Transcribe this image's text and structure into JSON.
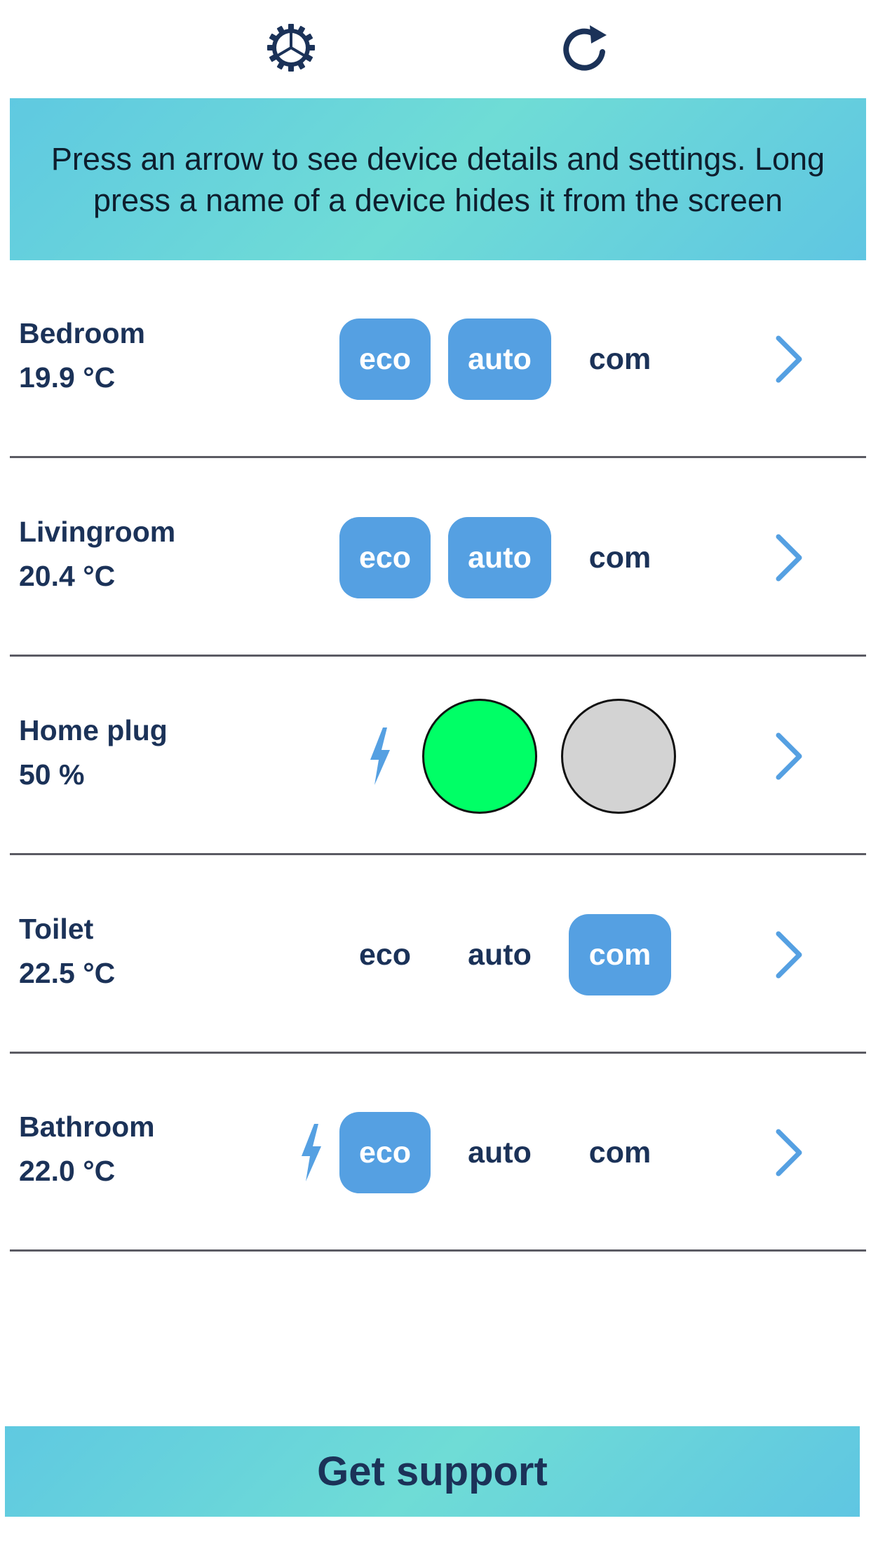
{
  "header": {
    "settings_icon": "gear-icon",
    "refresh_icon": "refresh-icon"
  },
  "info": {
    "text": "Press an arrow to see device details and settings. Long press a name of a device hides it from the screen"
  },
  "devices": [
    {
      "name": "Bedroom",
      "value": "19.9 °C",
      "modes": [
        "eco",
        "auto",
        "com"
      ],
      "active_modes": [
        "eco",
        "auto"
      ],
      "lightning": false
    },
    {
      "name": "Livingroom",
      "value": "20.4 °C",
      "modes": [
        "eco",
        "auto",
        "com"
      ],
      "active_modes": [
        "eco",
        "auto"
      ],
      "lightning": false
    },
    {
      "name": "Home plug",
      "value": "50 %",
      "lightning": true,
      "indicators": [
        {
          "name": "on-indicator",
          "color": "#00ff66"
        },
        {
          "name": "off-indicator",
          "color": "#d3d3d3"
        }
      ]
    },
    {
      "name": "Toilet",
      "value": "22.5 °C",
      "modes": [
        "eco",
        "auto",
        "com"
      ],
      "active_modes": [
        "com"
      ],
      "lightning": false
    },
    {
      "name": "Bathroom",
      "value": "22.0 °C",
      "modes": [
        "eco",
        "auto",
        "com"
      ],
      "active_modes": [
        "eco"
      ],
      "lightning": true
    }
  ],
  "support": {
    "label": "Get support"
  },
  "colors": {
    "accent": "#55a0e2",
    "text": "#1b3258",
    "banner": "#66d0de",
    "divider": "#5b5b63"
  }
}
